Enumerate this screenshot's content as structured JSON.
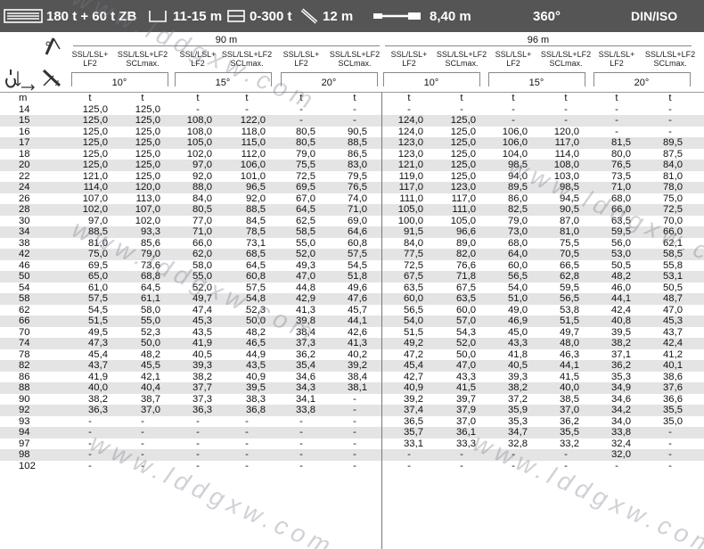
{
  "topbar": {
    "capacity": "180 t + 60 t ZB",
    "outrigger": "11-15 m",
    "counterweight": "0-300 t",
    "boom": "12 m",
    "width": "8,40 m",
    "slew": "360°",
    "standard": "DIN/ISO"
  },
  "header": {
    "group1_length": "90 m",
    "group2_length": "96 m",
    "columns": [
      {
        "line1": "SSL/LSL+",
        "line2": "LF2"
      },
      {
        "line1": "SSL/LSL+LF2",
        "line2": "SCLmax."
      },
      {
        "line1": "SSL/LSL+",
        "line2": "LF2"
      },
      {
        "line1": "SSL/LSL+LF2",
        "line2": "SCLmax."
      },
      {
        "line1": "SSL/LSL+",
        "line2": "LF2"
      },
      {
        "line1": "SSL/LSL+LF2",
        "line2": "SCLmax."
      },
      {
        "line1": "SSL/LSL+",
        "line2": "LF2"
      },
      {
        "line1": "SSL/LSL+LF2",
        "line2": "SCLmax."
      },
      {
        "line1": "SSL/LSL+",
        "line2": "LF2"
      },
      {
        "line1": "SSL/LSL+LF2",
        "line2": "SCLmax."
      },
      {
        "line1": "SSL/LSL+",
        "line2": "LF2"
      },
      {
        "line1": "SSL/LSL+LF2",
        "line2": "SCLmax."
      }
    ],
    "angles": [
      "10°",
      "15°",
      "20°",
      "10°",
      "15°",
      "20°"
    ]
  },
  "unit_row": [
    "m",
    "t",
    "t",
    "t",
    "t",
    "t",
    "t",
    "t",
    "t",
    "t",
    "t",
    "t",
    "t"
  ],
  "rows": [
    [
      "14",
      "125,0",
      "125,0",
      "-",
      "-",
      "-",
      "-",
      "-",
      "-",
      "-",
      "-",
      "-",
      "-"
    ],
    [
      "15",
      "125,0",
      "125,0",
      "108,0",
      "122,0",
      "-",
      "-",
      "124,0",
      "125,0",
      "-",
      "-",
      "-",
      "-"
    ],
    [
      "16",
      "125,0",
      "125,0",
      "108,0",
      "118,0",
      "80,5",
      "90,5",
      "124,0",
      "125,0",
      "106,0",
      "120,0",
      "-",
      "-"
    ],
    [
      "17",
      "125,0",
      "125,0",
      "105,0",
      "115,0",
      "80,5",
      "88,5",
      "123,0",
      "125,0",
      "106,0",
      "117,0",
      "81,5",
      "89,5"
    ],
    [
      "18",
      "125,0",
      "125,0",
      "102,0",
      "112,0",
      "79,0",
      "86,5",
      "123,0",
      "125,0",
      "104,0",
      "114,0",
      "80,0",
      "87,5"
    ],
    [
      "20",
      "125,0",
      "125,0",
      "97,0",
      "106,0",
      "75,5",
      "83,0",
      "121,0",
      "125,0",
      "98,5",
      "108,0",
      "76,5",
      "84,0"
    ],
    [
      "22",
      "121,0",
      "125,0",
      "92,0",
      "101,0",
      "72,5",
      "79,5",
      "119,0",
      "125,0",
      "94,0",
      "103,0",
      "73,5",
      "81,0"
    ],
    [
      "24",
      "114,0",
      "120,0",
      "88,0",
      "96,5",
      "69,5",
      "76,5",
      "117,0",
      "123,0",
      "89,5",
      "98,5",
      "71,0",
      "78,0"
    ],
    [
      "26",
      "107,0",
      "113,0",
      "84,0",
      "92,0",
      "67,0",
      "74,0",
      "111,0",
      "117,0",
      "86,0",
      "94,5",
      "68,0",
      "75,0"
    ],
    [
      "28",
      "102,0",
      "107,0",
      "80,5",
      "88,5",
      "64,5",
      "71,0",
      "105,0",
      "111,0",
      "82,5",
      "90,5",
      "66,0",
      "72,5"
    ],
    [
      "30",
      "97,0",
      "102,0",
      "77,0",
      "84,5",
      "62,5",
      "69,0",
      "100,0",
      "105,0",
      "79,0",
      "87,0",
      "63,5",
      "70,0"
    ],
    [
      "34",
      "88,5",
      "93,3",
      "71,0",
      "78,5",
      "58,5",
      "64,6",
      "91,5",
      "96,6",
      "73,0",
      "81,0",
      "59,5",
      "66,0"
    ],
    [
      "38",
      "81,0",
      "85,6",
      "66,0",
      "73,1",
      "55,0",
      "60,8",
      "84,0",
      "89,0",
      "68,0",
      "75,5",
      "56,0",
      "62,1"
    ],
    [
      "42",
      "75,0",
      "79,0",
      "62,0",
      "68,5",
      "52,0",
      "57,5",
      "77,5",
      "82,0",
      "64,0",
      "70,5",
      "53,0",
      "58,5"
    ],
    [
      "46",
      "69,5",
      "73,6",
      "58,0",
      "64,5",
      "49,3",
      "54,5",
      "72,5",
      "76,6",
      "60,0",
      "66,5",
      "50,5",
      "55,8"
    ],
    [
      "50",
      "65,0",
      "68,8",
      "55,0",
      "60,8",
      "47,0",
      "51,8",
      "67,5",
      "71,8",
      "56,5",
      "62,8",
      "48,2",
      "53,1"
    ],
    [
      "54",
      "61,0",
      "64,5",
      "52,0",
      "57,5",
      "44,8",
      "49,6",
      "63,5",
      "67,5",
      "54,0",
      "59,5",
      "46,0",
      "50,5"
    ],
    [
      "58",
      "57,5",
      "61,1",
      "49,7",
      "54,8",
      "42,9",
      "47,6",
      "60,0",
      "63,5",
      "51,0",
      "56,5",
      "44,1",
      "48,7"
    ],
    [
      "62",
      "54,5",
      "58,0",
      "47,4",
      "52,3",
      "41,3",
      "45,7",
      "56,5",
      "60,0",
      "49,0",
      "53,8",
      "42,4",
      "47,0"
    ],
    [
      "66",
      "51,5",
      "55,0",
      "45,3",
      "50,0",
      "39,8",
      "44,1",
      "54,0",
      "57,0",
      "46,9",
      "51,5",
      "40,8",
      "45,3"
    ],
    [
      "70",
      "49,5",
      "52,3",
      "43,5",
      "48,2",
      "38,4",
      "42,6",
      "51,5",
      "54,3",
      "45,0",
      "49,7",
      "39,5",
      "43,7"
    ],
    [
      "74",
      "47,3",
      "50,0",
      "41,9",
      "46,5",
      "37,3",
      "41,3",
      "49,2",
      "52,0",
      "43,3",
      "48,0",
      "38,2",
      "42,4"
    ],
    [
      "78",
      "45,4",
      "48,2",
      "40,5",
      "44,9",
      "36,2",
      "40,2",
      "47,2",
      "50,0",
      "41,8",
      "46,3",
      "37,1",
      "41,2"
    ],
    [
      "82",
      "43,7",
      "45,5",
      "39,3",
      "43,5",
      "35,4",
      "39,2",
      "45,4",
      "47,0",
      "40,5",
      "44,1",
      "36,2",
      "40,1"
    ],
    [
      "86",
      "41,9",
      "42,1",
      "38,2",
      "40,9",
      "34,6",
      "38,4",
      "42,7",
      "43,3",
      "39,3",
      "41,5",
      "35,3",
      "38,6"
    ],
    [
      "88",
      "40,0",
      "40,4",
      "37,7",
      "39,5",
      "34,3",
      "38,1",
      "40,9",
      "41,5",
      "38,2",
      "40,0",
      "34,9",
      "37,6"
    ],
    [
      "90",
      "38,2",
      "38,7",
      "37,3",
      "38,3",
      "34,1",
      "-",
      "39,2",
      "39,7",
      "37,2",
      "38,5",
      "34,6",
      "36,6"
    ],
    [
      "92",
      "36,3",
      "37,0",
      "36,3",
      "36,8",
      "33,8",
      "-",
      "37,4",
      "37,9",
      "35,9",
      "37,0",
      "34,2",
      "35,5"
    ],
    [
      "93",
      "-",
      "-",
      "-",
      "-",
      "-",
      "-",
      "36,5",
      "37,0",
      "35,3",
      "36,2",
      "34,0",
      "35,0"
    ],
    [
      "94",
      "-",
      "-",
      "-",
      "-",
      "-",
      "-",
      "35,7",
      "36,1",
      "34,7",
      "35,5",
      "33,8",
      "-"
    ],
    [
      "97",
      "-",
      "-",
      "-",
      "-",
      "-",
      "-",
      "33,1",
      "33,3",
      "32,8",
      "33,2",
      "32,4",
      "-"
    ],
    [
      "98",
      "-",
      "-",
      "-",
      "-",
      "-",
      "-",
      "-",
      "-",
      "-",
      "-",
      "32,0",
      "-"
    ],
    [
      "102",
      "-",
      "-",
      "-",
      "-",
      "-",
      "-",
      "-",
      "-",
      "-",
      "-",
      "-",
      "-"
    ]
  ],
  "watermark": "www.lddgxw.com"
}
